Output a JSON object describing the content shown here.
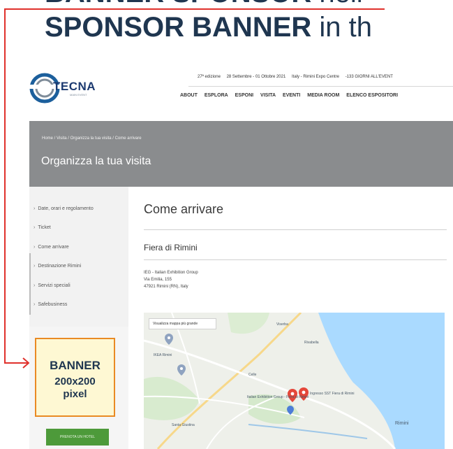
{
  "headline": {
    "line1": "BANNER SPONSOR",
    "line1_rest": " nell",
    "line2_bold": "SPONSOR BANNER",
    "line2_rest": " in th"
  },
  "logo": {
    "brand": "TECNA",
    "tagline": "MAIN EVENT"
  },
  "info_bar": {
    "edition": "27ª edizione",
    "dates": "28 Settembre - 01 Ottobre 2021",
    "location": "Italy - Rimini Expo Centre",
    "countdown": "-133 GIORNI ALL'EVENT"
  },
  "nav": [
    "ABOUT",
    "ESPLORA",
    "ESPONI",
    "VISITA",
    "EVENTI",
    "MEDIA ROOM",
    "ELENCO ESPOSITORI"
  ],
  "hero": {
    "breadcrumb": "Home / Visita / Organizza la tua visita / Come arrivare",
    "title": "Organizza la tua visita"
  },
  "sidebar": {
    "items": [
      "Date, orari e regolamento",
      "Ticket",
      "Come arrivare",
      "Destinazione Rimini",
      "Servizi speciali",
      "Safebusiness"
    ]
  },
  "banner": {
    "line1": "BANNER",
    "line2": "200x200",
    "line3": "pixel"
  },
  "hotel_button": "PRENOTA UN HOTEL",
  "content": {
    "title": "Come arrivare",
    "place": "Fiera di Rimini",
    "address": [
      "IEG - Italian Exhibition Group",
      "Via Emilia, 155",
      "47921 Rimini (RN), Italy"
    ]
  },
  "map": {
    "button": "Visualizza mappa più grande",
    "labels": {
      "ikea": "IKEA Rimini",
      "marker1": "Italian Exhibition Group - Fiera di Rimini",
      "marker2": "Ingresso SST Fiera di Rimini",
      "city": "Rimini",
      "road": "Santa Giustina",
      "area1": "Viserba",
      "area2": "Rivabella",
      "area3": "Celle"
    }
  },
  "colors": {
    "accent_red": "#e0312c",
    "banner_border": "#e98a23",
    "banner_fill": "#fef8d3",
    "hero_grey": "#8a8c8e",
    "hotel_green": "#4d9a3a",
    "navy": "#1f3650"
  }
}
